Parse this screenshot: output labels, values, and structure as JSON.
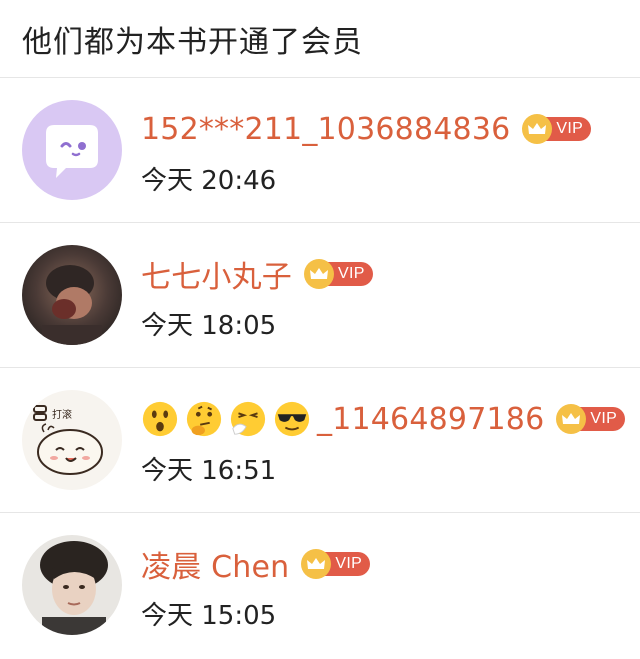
{
  "header": {
    "title": "他们都为本书开通了会员"
  },
  "members": [
    {
      "name": "152***211_1036884836",
      "emoji": [],
      "badge": "VIP",
      "time": "今天 20:46"
    },
    {
      "name": "七七小丸子",
      "emoji": [],
      "badge": "VIP",
      "time": "今天 18:05"
    },
    {
      "name": "_11464897186",
      "emoji": [
        "astonished-face",
        "thinking-face",
        "sneezing-face",
        "sunglasses-face"
      ],
      "badge": "VIP",
      "time": "今天 16:51"
    },
    {
      "name": "凌晨 Chen",
      "emoji": [],
      "badge": "VIP",
      "time": "今天 15:05"
    }
  ],
  "colors": {
    "name": "#d9603c",
    "vip_label_bg": "#e15b48",
    "vip_crown_bg": "#f5c046",
    "divider": "#e6e6e6"
  }
}
